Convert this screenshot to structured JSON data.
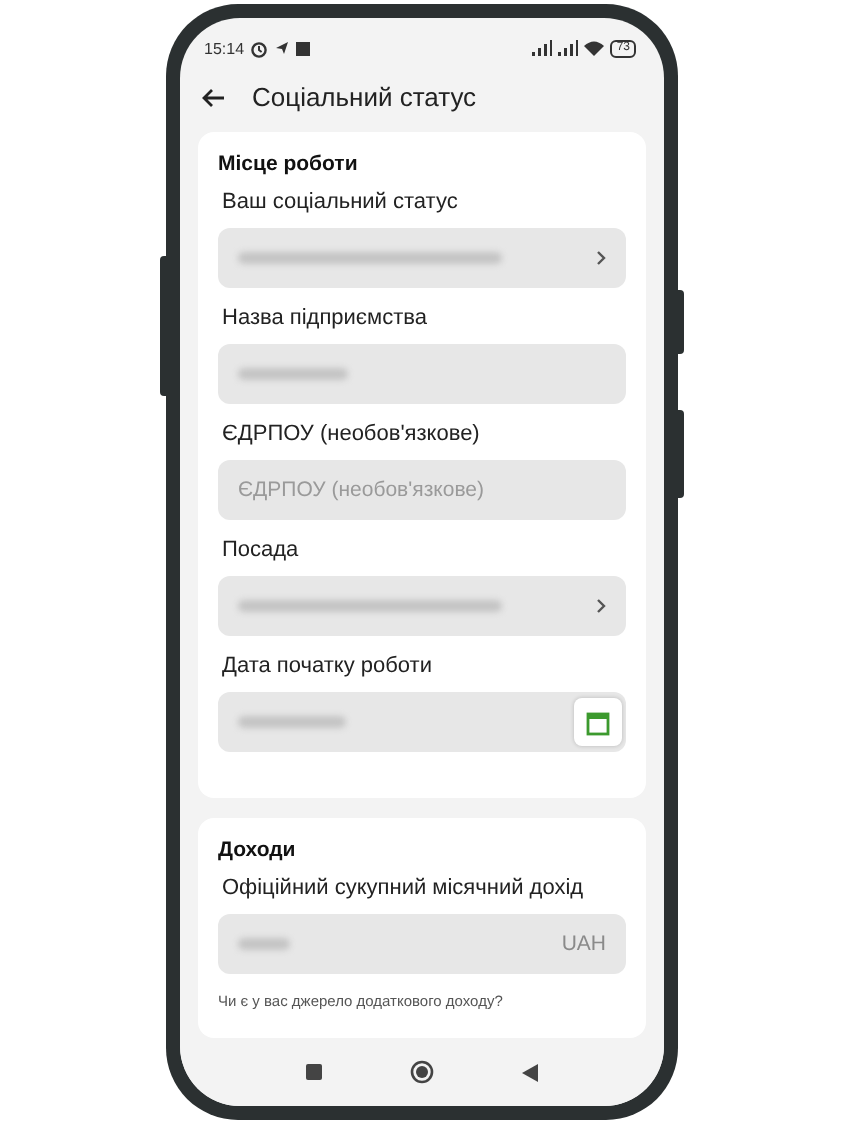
{
  "status_bar": {
    "time": "15:14",
    "battery": "73"
  },
  "app_bar": {
    "title": "Соціальний статус"
  },
  "sections": [
    {
      "title": "Місце роботи",
      "fields": [
        {
          "label": "Ваш соціальний статус",
          "kind": "select",
          "blurred": true
        },
        {
          "label": "Назва підприємства",
          "kind": "text",
          "blurred": true
        },
        {
          "label": "ЄДРПОУ (необов'язкове)",
          "kind": "text",
          "placeholder": "ЄДРПОУ (необов'язкове)",
          "blurred": false
        },
        {
          "label": "Посада",
          "kind": "select",
          "blurred": true
        },
        {
          "label": "Дата початку роботи",
          "kind": "date",
          "blurred": true
        }
      ]
    },
    {
      "title": "Доходи",
      "fields": [
        {
          "label": "Офіційний сукупний місячний дохід",
          "kind": "amount",
          "suffix": "UAH",
          "blurred": true
        }
      ],
      "question": "Чи є у вас джерело додаткового доходу?"
    }
  ]
}
